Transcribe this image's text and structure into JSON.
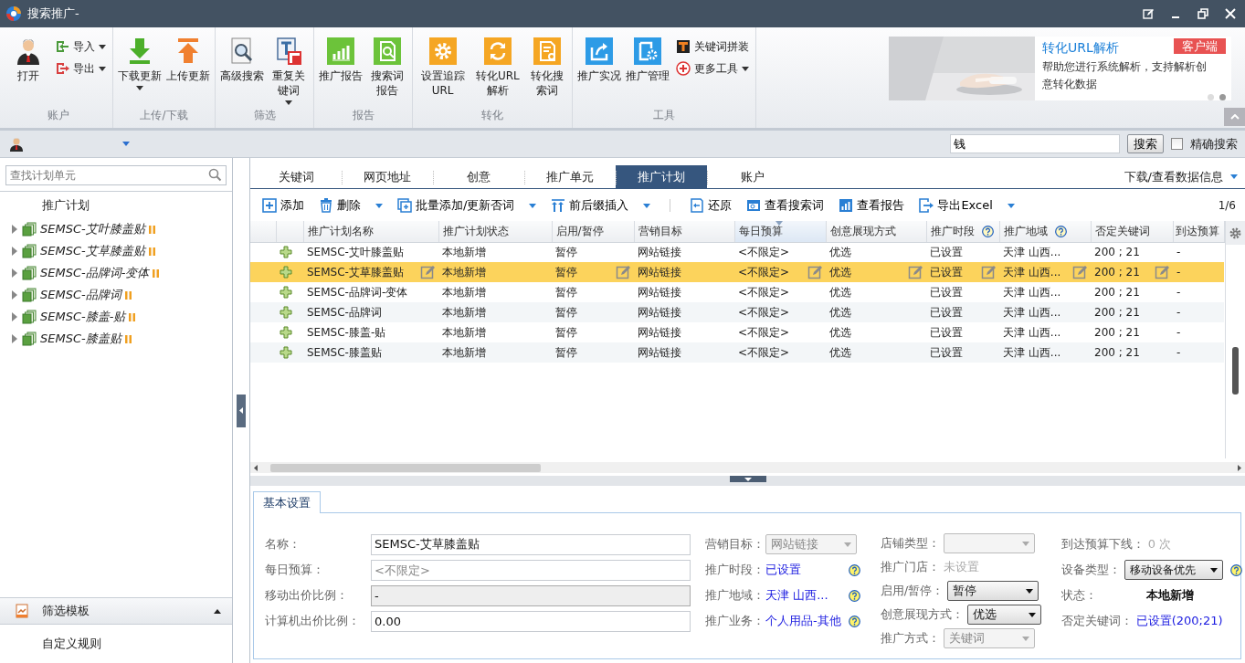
{
  "window": {
    "title": "搜索推广-"
  },
  "ribbon": {
    "groups": [
      {
        "label": "账户",
        "buttons": [
          {
            "kind": "large",
            "label": "打开",
            "menu": false
          },
          {
            "kind": "small",
            "label": "导入",
            "menu": true
          },
          {
            "kind": "small",
            "label": "导出",
            "menu": true
          }
        ]
      },
      {
        "label": "上传/下载",
        "buttons": [
          {
            "kind": "large",
            "label": "下载更新",
            "menu": true
          },
          {
            "kind": "large",
            "label": "上传更新",
            "menu": false
          }
        ]
      },
      {
        "label": "筛选",
        "buttons": [
          {
            "kind": "large",
            "label": "高级搜索",
            "menu": false
          },
          {
            "kind": "large",
            "label": "重复关键词",
            "menu": true
          }
        ]
      },
      {
        "label": "报告",
        "buttons": [
          {
            "kind": "large",
            "label": "推广报告",
            "menu": false
          },
          {
            "kind": "large",
            "label": "搜索词报告",
            "menu": false
          }
        ]
      },
      {
        "label": "转化",
        "buttons": [
          {
            "kind": "large",
            "label": "设置追踪URL",
            "menu": false
          },
          {
            "kind": "large",
            "label": "转化URL解析",
            "menu": false
          },
          {
            "kind": "large",
            "label": "转化搜索词",
            "menu": false
          }
        ]
      },
      {
        "label": "工具",
        "buttons": [
          {
            "kind": "large",
            "label": "推广实况",
            "menu": false
          },
          {
            "kind": "large",
            "label": "推广管理",
            "menu": false
          },
          {
            "kind": "small",
            "label": "关键词拼装",
            "menu": false
          },
          {
            "kind": "small",
            "label": "更多工具",
            "menu": true
          }
        ]
      }
    ]
  },
  "banner": {
    "kind": "picture",
    "title": "转化URL解析",
    "badge": "客户端",
    "text": "帮助您进行系统解析，支持解析创意转化数据",
    "dots": [
      {
        "selected": false
      },
      {
        "selected": true
      }
    ]
  },
  "account_bar": {
    "search_value": "钱",
    "search_button": "搜索",
    "exact": {
      "label": "精确搜索",
      "checked": false
    }
  },
  "sidebar": {
    "placeholder": "查找计划单元",
    "header": "推广计划",
    "items": [
      {
        "label": "SEMSC-艾叶膝盖贴",
        "expanded": false,
        "paused": true
      },
      {
        "label": "SEMSC-艾草膝盖贴",
        "expanded": false,
        "paused": true
      },
      {
        "label": "SEMSC-品牌词-变体",
        "expanded": false,
        "paused": true
      },
      {
        "label": "SEMSC-品牌词",
        "expanded": false,
        "paused": true
      },
      {
        "label": "SEMSC-膝盖-贴",
        "expanded": false,
        "paused": true
      },
      {
        "label": "SEMSC-膝盖贴",
        "expanded": false,
        "paused": true
      }
    ],
    "footer": [
      {
        "label": "筛选模板",
        "kind": "collapsible"
      },
      {
        "label": "自定义规则",
        "kind": "plain"
      }
    ]
  },
  "tabs": [
    {
      "label": "关键词",
      "selected": false
    },
    {
      "label": "网页地址",
      "selected": false
    },
    {
      "label": "创意",
      "selected": false
    },
    {
      "label": "推广单元",
      "selected": false
    },
    {
      "label": "推广计划",
      "selected": true
    },
    {
      "label": "账户",
      "selected": false
    }
  ],
  "download_info": "下载/查看数据信息",
  "toolbar": [
    {
      "label": "添加",
      "menu": false
    },
    {
      "label": "删除",
      "menu": true
    },
    {
      "label": "批量添加/更新否词",
      "menu": true
    },
    {
      "label": "前后缀插入",
      "menu": true
    },
    {
      "label": "还原",
      "menu": false
    },
    {
      "label": "查看搜索词",
      "menu": false
    },
    {
      "label": "查看报告",
      "menu": false
    },
    {
      "label": "导出Excel",
      "menu": true
    }
  ],
  "page_indicator": "1/6",
  "table": {
    "columns": [
      {
        "label": "推广计划名称",
        "help": false,
        "sorted": false,
        "editable": true
      },
      {
        "label": "推广计划状态",
        "help": false,
        "sorted": false,
        "editable": false
      },
      {
        "label": "启用/暂停",
        "help": false,
        "sorted": false,
        "editable": true
      },
      {
        "label": "营销目标",
        "help": false,
        "sorted": false,
        "editable": false
      },
      {
        "label": "每日预算",
        "help": false,
        "sorted": true,
        "editable": true
      },
      {
        "label": "创意展现方式",
        "help": false,
        "sorted": false,
        "editable": true
      },
      {
        "label": "推广时段",
        "help": true,
        "sorted": false,
        "editable": true
      },
      {
        "label": "推广地域",
        "help": true,
        "sorted": false,
        "editable": true
      },
      {
        "label": "否定关键词",
        "help": false,
        "sorted": false,
        "editable": true
      },
      {
        "label": "到达预算",
        "help": false,
        "sorted": false,
        "editable": false
      }
    ],
    "rows": [
      {
        "selected": false,
        "cells": [
          "SEMSC-艾叶膝盖贴",
          "本地新增",
          "暂停",
          "网站链接",
          "<不限定>",
          "优选",
          "已设置",
          "天津 山西...",
          "200 ; 21",
          "-"
        ]
      },
      {
        "selected": true,
        "cells": [
          "SEMSC-艾草膝盖贴",
          "本地新增",
          "暂停",
          "网站链接",
          "<不限定>",
          "优选",
          "已设置",
          "天津 山西...",
          "200 ; 21",
          "-"
        ]
      },
      {
        "selected": false,
        "cells": [
          "SEMSC-品牌词-变体",
          "本地新增",
          "暂停",
          "网站链接",
          "<不限定>",
          "优选",
          "已设置",
          "天津 山西...",
          "200 ; 21",
          "-"
        ]
      },
      {
        "selected": false,
        "cells": [
          "SEMSC-品牌词",
          "本地新增",
          "暂停",
          "网站链接",
          "<不限定>",
          "优选",
          "已设置",
          "天津 山西...",
          "200 ; 21",
          "-"
        ]
      },
      {
        "selected": false,
        "cells": [
          "SEMSC-膝盖-贴",
          "本地新增",
          "暂停",
          "网站链接",
          "<不限定>",
          "优选",
          "已设置",
          "天津 山西...",
          "200 ; 21",
          "-"
        ]
      },
      {
        "selected": false,
        "cells": [
          "SEMSC-膝盖贴",
          "本地新增",
          "暂停",
          "网站链接",
          "<不限定>",
          "优选",
          "已设置",
          "天津 山西...",
          "200 ; 21",
          "-"
        ]
      }
    ]
  },
  "detail": {
    "tabs": [
      {
        "label": "基本设置",
        "selected": true
      }
    ],
    "columns": [
      [
        {
          "kind": "input",
          "label": "名称：",
          "value": "SEMSC-艾草膝盖贴",
          "disabled": false
        },
        {
          "kind": "input",
          "label": "每日预算：",
          "placeholder": "<不限定>",
          "disabled": false
        },
        {
          "kind": "input",
          "label": "移动出价比例：",
          "value": "-",
          "disabled": true
        },
        {
          "kind": "input",
          "label": "计算机出价比例：",
          "value": "0.00",
          "disabled": false
        }
      ],
      [
        {
          "kind": "select",
          "label": "营销目标：",
          "value": "网站链接",
          "disabled": true
        },
        {
          "kind": "link",
          "label": "推广时段：",
          "value": "已设置",
          "help": true
        },
        {
          "kind": "link",
          "label": "推广地域：",
          "value": "天津 山西...",
          "help": true
        },
        {
          "kind": "link",
          "label": "推广业务：",
          "value": "个人用品-其他",
          "help": true
        }
      ],
      [
        {
          "kind": "select",
          "label": "店铺类型：",
          "disabled": true
        },
        {
          "kind": "text",
          "label": "推广门店：",
          "value": "未设置",
          "muted": true
        },
        {
          "kind": "select",
          "label": "启用/暂停：",
          "value": "暂停",
          "disabled": false
        },
        {
          "kind": "select",
          "label": "创意展现方式：",
          "value": "优选",
          "disabled": false
        },
        {
          "kind": "select",
          "label": "推广方式：",
          "value": "关键词",
          "disabled": true
        }
      ],
      [
        {
          "kind": "text",
          "label": "到达预算下线：",
          "value": "0 次",
          "muted": true
        },
        {
          "kind": "select",
          "label": "设备类型：",
          "value": "移动设备优先",
          "disabled": false,
          "help": true
        },
        {
          "kind": "strong",
          "label": "状态：",
          "value": "本地新增"
        },
        {
          "kind": "link",
          "label": "否定关键词：",
          "value": "已设置(200;21)"
        }
      ]
    ]
  }
}
